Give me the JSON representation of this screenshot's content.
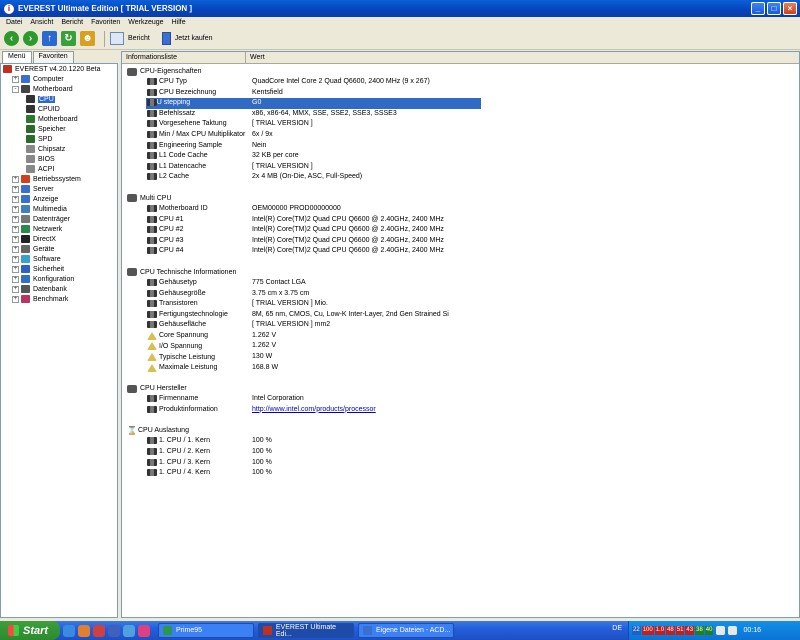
{
  "window": {
    "title": "EVEREST Ultimate Edition  [ TRIAL VERSION ]"
  },
  "menu": [
    "Datei",
    "Ansicht",
    "Bericht",
    "Favoriten",
    "Werkzeuge",
    "Hilfe"
  ],
  "toolbar": {
    "report_label": "Bericht",
    "buy_label": "Jetzt kaufen"
  },
  "left_tabs": [
    "Menü",
    "Favoriten"
  ],
  "tree": [
    {
      "label": "EVEREST v4.20.1220 Beta",
      "level": 0,
      "exp": "",
      "color": "#c03020"
    },
    {
      "label": "Computer",
      "level": 1,
      "exp": "+",
      "color": "#3a6ed0"
    },
    {
      "label": "Motherboard",
      "level": 1,
      "exp": "-",
      "color": "#444"
    },
    {
      "label": "CPU",
      "level": 2,
      "exp": "",
      "color": "#333",
      "selected": true
    },
    {
      "label": "CPUID",
      "level": 2,
      "exp": "",
      "color": "#333"
    },
    {
      "label": "Motherboard",
      "level": 2,
      "exp": "",
      "color": "#2a7a2a"
    },
    {
      "label": "Speicher",
      "level": 2,
      "exp": "",
      "color": "#2a6a2a"
    },
    {
      "label": "SPD",
      "level": 2,
      "exp": "",
      "color": "#2a6a2a"
    },
    {
      "label": "Chipsatz",
      "level": 2,
      "exp": "",
      "color": "#888"
    },
    {
      "label": "BIOS",
      "level": 2,
      "exp": "",
      "color": "#888"
    },
    {
      "label": "ACPI",
      "level": 2,
      "exp": "",
      "color": "#888"
    },
    {
      "label": "Betriebssystem",
      "level": 1,
      "exp": "+",
      "color": "#d04020"
    },
    {
      "label": "Server",
      "level": 1,
      "exp": "+",
      "color": "#3a6ed0"
    },
    {
      "label": "Anzeige",
      "level": 1,
      "exp": "+",
      "color": "#3a6ed0"
    },
    {
      "label": "Multimedia",
      "level": 1,
      "exp": "+",
      "color": "#4080c0"
    },
    {
      "label": "Datenträger",
      "level": 1,
      "exp": "+",
      "color": "#777"
    },
    {
      "label": "Netzwerk",
      "level": 1,
      "exp": "+",
      "color": "#2a8a4a"
    },
    {
      "label": "DirectX",
      "level": 1,
      "exp": "+",
      "color": "#222"
    },
    {
      "label": "Geräte",
      "level": 1,
      "exp": "+",
      "color": "#666"
    },
    {
      "label": "Software",
      "level": 1,
      "exp": "+",
      "color": "#3aa0d0"
    },
    {
      "label": "Sicherheit",
      "level": 1,
      "exp": "+",
      "color": "#3060c0"
    },
    {
      "label": "Konfiguration",
      "level": 1,
      "exp": "+",
      "color": "#3070c0"
    },
    {
      "label": "Datenbank",
      "level": 1,
      "exp": "+",
      "color": "#555"
    },
    {
      "label": "Benchmark",
      "level": 1,
      "exp": "+",
      "color": "#c03060"
    }
  ],
  "columns": [
    "Informationsliste",
    "Wert"
  ],
  "groups": [
    {
      "title": "CPU-Eigenschaften",
      "icon": "cpu",
      "rows": [
        {
          "k": "CPU Typ",
          "v": "QuadCore Intel Core 2 Quad Q6600, 2400 MHz (9 x 267)",
          "i": "cpu"
        },
        {
          "k": "CPU Bezeichnung",
          "v": "Kentsfield",
          "i": "cpu"
        },
        {
          "k": "CPU stepping",
          "v": "G0",
          "i": "cpu",
          "selected": true
        },
        {
          "k": "Befehlssatz",
          "v": "x86, x86-64, MMX, SSE, SSE2, SSE3, SSSE3",
          "i": "cpu"
        },
        {
          "k": "Vorgesehene Taktung",
          "v": "[ TRIAL VERSION ]",
          "i": "cpu"
        },
        {
          "k": "Min / Max CPU Multiplikator",
          "v": "6x / 9x",
          "i": "cpu"
        },
        {
          "k": "Engineering Sample",
          "v": "Nein",
          "i": "cpu"
        },
        {
          "k": "L1 Code Cache",
          "v": "32 KB per core",
          "i": "cpu"
        },
        {
          "k": "L1 Datencache",
          "v": "[ TRIAL VERSION ]",
          "i": "cpu"
        },
        {
          "k": "L2 Cache",
          "v": "2x 4 MB  (On-Die, ASC, Full-Speed)",
          "i": "cpu"
        }
      ]
    },
    {
      "title": "Multi CPU",
      "icon": "cpu",
      "rows": [
        {
          "k": "Motherboard ID",
          "v": "OEM00000 PROD00000000",
          "i": "cpu"
        },
        {
          "k": "CPU #1",
          "v": "Intel(R) Core(TM)2 Quad CPU Q6600 @ 2.40GHz, 2400 MHz",
          "i": "cpu"
        },
        {
          "k": "CPU #2",
          "v": "Intel(R) Core(TM)2 Quad CPU Q6600 @ 2.40GHz, 2400 MHz",
          "i": "cpu"
        },
        {
          "k": "CPU #3",
          "v": "Intel(R) Core(TM)2 Quad CPU Q6600 @ 2.40GHz, 2400 MHz",
          "i": "cpu"
        },
        {
          "k": "CPU #4",
          "v": "Intel(R) Core(TM)2 Quad CPU Q6600 @ 2.40GHz, 2400 MHz",
          "i": "cpu"
        }
      ]
    },
    {
      "title": "CPU Technische Informationen",
      "icon": "cpu",
      "rows": [
        {
          "k": "Gehäusetyp",
          "v": "775 Contact LGA",
          "i": "cpu"
        },
        {
          "k": "Gehäusegröße",
          "v": "3.75 cm x 3.75 cm",
          "i": "cpu"
        },
        {
          "k": "Transistoren",
          "v": "[ TRIAL VERSION ] Mio.",
          "i": "cpu"
        },
        {
          "k": "Fertigungstechnologie",
          "v": "8M, 65 nm, CMOS, Cu, Low-K Inter-Layer, 2nd Gen Strained Si",
          "i": "cpu"
        },
        {
          "k": "Gehäusefläche",
          "v": "[ TRIAL VERSION ] mm2",
          "i": "cpu"
        },
        {
          "k": "Core Spannung",
          "v": "1.262 V",
          "i": "warn"
        },
        {
          "k": "I/O Spannung",
          "v": "1.262 V",
          "i": "warn"
        },
        {
          "k": "Typische Leistung",
          "v": "130 W",
          "i": "warn"
        },
        {
          "k": "Maximale Leistung",
          "v": "168.8 W",
          "i": "warn"
        }
      ]
    },
    {
      "title": "CPU Hersteller",
      "icon": "cpu",
      "rows": [
        {
          "k": "Firmenname",
          "v": "Intel Corporation",
          "i": "cpu"
        },
        {
          "k": "Produktinformation",
          "v": "http://www.intel.com/products/processor",
          "i": "cpu",
          "link": true
        }
      ]
    },
    {
      "title": "CPU Auslastung",
      "icon": "sand",
      "rows": [
        {
          "k": "1. CPU / 1. Kern",
          "v": "100 %",
          "i": "cpu"
        },
        {
          "k": "1. CPU / 2. Kern",
          "v": "100 %",
          "i": "cpu"
        },
        {
          "k": "1. CPU / 3. Kern",
          "v": "100 %",
          "i": "cpu"
        },
        {
          "k": "1. CPU / 4. Kern",
          "v": "100 %",
          "i": "cpu"
        }
      ]
    }
  ],
  "taskbar": {
    "start": "Start",
    "tasks": [
      {
        "label": "Prime95",
        "color": "#2a9a4a"
      },
      {
        "label": "EVEREST Ultimate Edi...",
        "color": "#c03020",
        "active": true
      },
      {
        "label": "Eigene Dateien - ACD...",
        "color": "#3a6ed0"
      }
    ],
    "lang": "DE",
    "tray_temps": [
      "22",
      "100",
      "1.0",
      "48",
      "51",
      "43",
      "38",
      "40"
    ],
    "clock": "00:16"
  }
}
